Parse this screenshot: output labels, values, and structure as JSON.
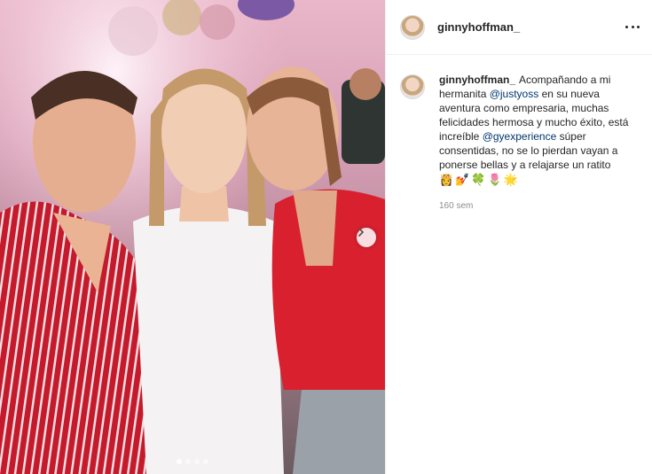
{
  "post": {
    "username": "ginnyhoffman_",
    "more_icon": "more-horizontal-icon",
    "next_icon": "chevron-right-icon",
    "carousel": {
      "count": 4,
      "active_index": 0
    }
  },
  "caption": {
    "username": "ginnyhoffman_",
    "text_1": "Acompañando a mi hermanita ",
    "mention_1": "@justyoss",
    "text_2": " en su nueva aventura como empresaria, muchas felicidades hermosa y mucho éxito, está increíble ",
    "mention_2": "@gyexperience",
    "text_3": " súper consentidas, no se lo pierdan vayan a ponerse bellas y a relajarse un ratito",
    "emojis": "👸💅🍀🌷🌟",
    "time": "160 sem"
  },
  "colors": {
    "mention": "#00376b",
    "muted": "#8e8e8e",
    "border": "#efefef"
  }
}
